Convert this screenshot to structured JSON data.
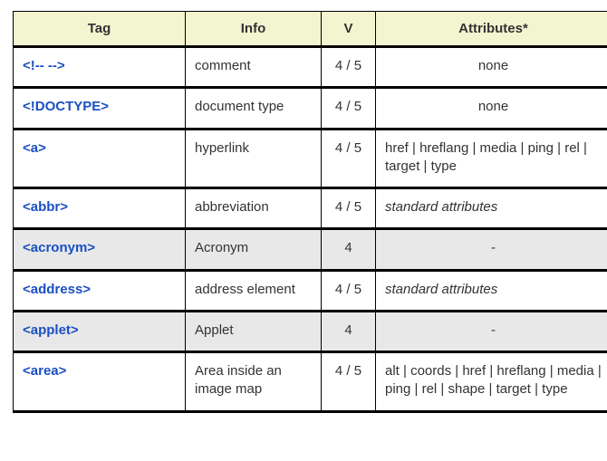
{
  "headers": {
    "tag": "Tag",
    "info": "Info",
    "v": "V",
    "attributes": "Attributes*"
  },
  "rows": [
    {
      "tag": "<!-- -->",
      "info": "comment",
      "v": "4 / 5",
      "attr": "none",
      "attr_style": "center",
      "deprecated": false
    },
    {
      "tag": "<!DOCTYPE>",
      "info": "document type",
      "v": "4 / 5",
      "attr": "none",
      "attr_style": "center",
      "deprecated": false
    },
    {
      "tag": "<a>",
      "info": "hyperlink",
      "v": "4 / 5",
      "attr": "href | hreflang | media | ping | rel | target | type",
      "attr_style": "left",
      "deprecated": false
    },
    {
      "tag": "<abbr>",
      "info": "abbreviation",
      "v": "4 / 5",
      "attr": "standard attributes",
      "attr_style": "italic",
      "deprecated": false
    },
    {
      "tag": "<acronym>",
      "info": "Acronym",
      "v": "4",
      "attr": "-",
      "attr_style": "center",
      "deprecated": true
    },
    {
      "tag": "<address>",
      "info": "address element",
      "v": "4 / 5",
      "attr": "standard attributes",
      "attr_style": "italic",
      "deprecated": false
    },
    {
      "tag": "<applet>",
      "info": "Applet",
      "v": "4",
      "attr": "-",
      "attr_style": "center",
      "deprecated": true
    },
    {
      "tag": "<area>",
      "info": "Area inside an image map",
      "v": "4 / 5",
      "attr": "alt | coords | href | hreflang | media | ping | rel | shape | target | type",
      "attr_style": "left",
      "deprecated": false
    }
  ]
}
